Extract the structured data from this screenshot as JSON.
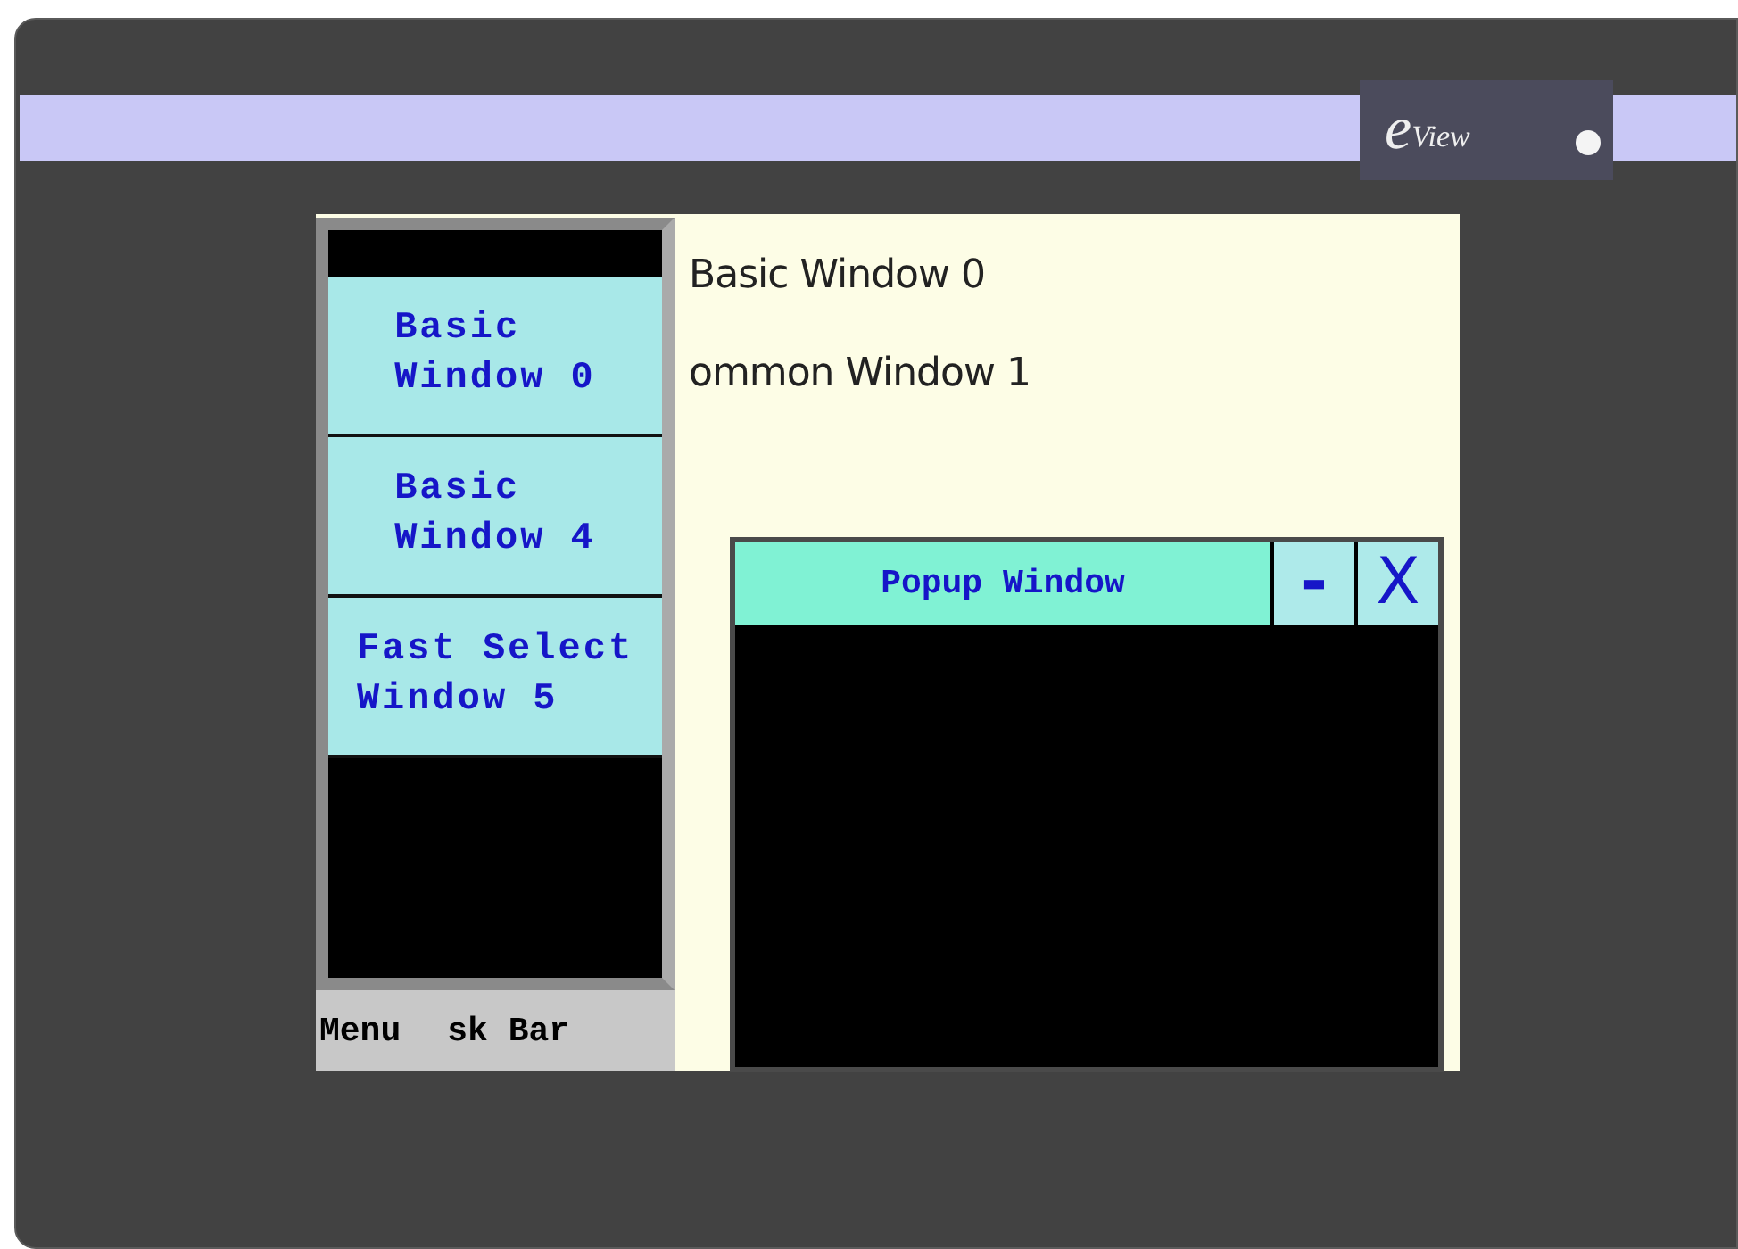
{
  "brand": {
    "initial": "e",
    "name": "View"
  },
  "screen": {
    "background_texts": [
      "Basic Window 0",
      "ommon Window 1"
    ],
    "menu": {
      "items": [
        {
          "lines": [
            "Basic",
            "Window 0"
          ]
        },
        {
          "lines": [
            "Basic",
            "Window 4"
          ]
        },
        {
          "lines": [
            "Fast Select",
            "Window 5"
          ]
        }
      ],
      "footer": [
        "Menu",
        "sk Bar"
      ]
    },
    "popup": {
      "title": "Popup Window",
      "minimize": "-",
      "close": "X"
    }
  }
}
